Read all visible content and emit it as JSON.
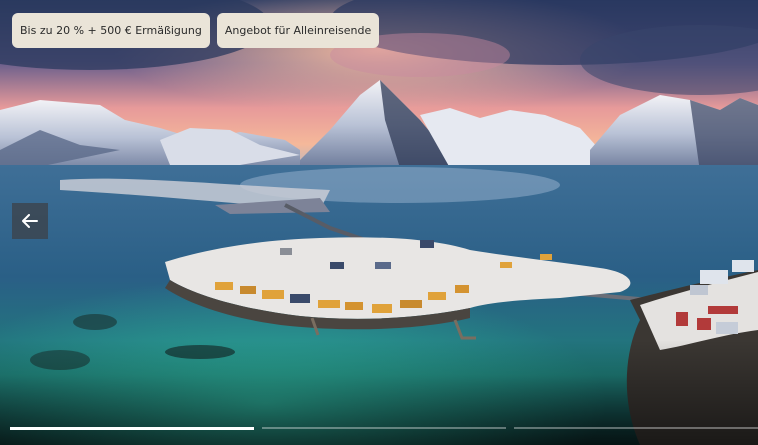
{
  "badges": [
    {
      "label": "Bis zu 20 % + 500 € Ermäßigung"
    },
    {
      "label": "Angebot für Alleinreisende"
    }
  ],
  "gallery": {
    "image_subject": "Winter aerial view of Lofoten fishing village with snowy mountains and fjord",
    "prev_icon": "arrow-left-icon",
    "slides_total": 3,
    "active_slide": 1
  },
  "colors": {
    "badge_bg": "#eae4d8",
    "nav_bg": "#3c424a",
    "progress_active": "#ffffff"
  }
}
